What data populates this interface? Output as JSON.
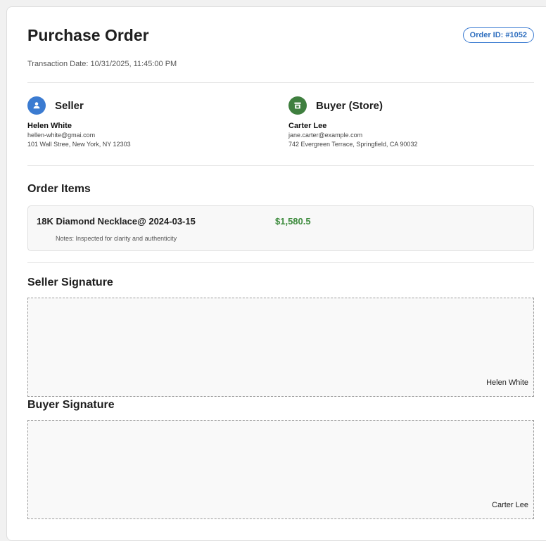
{
  "header": {
    "title": "Purchase Order",
    "order_id": "Order ID: #1052",
    "transaction_date": "Transaction Date: 10/31/2025, 11:45:00 PM"
  },
  "seller": {
    "heading": "Seller",
    "icon": "person-icon",
    "icon_color": "#3b7bd1",
    "name": "Helen White",
    "email": "hellen-white@gmai.com",
    "address": "101 Wall Stree, New York, NY 12303"
  },
  "buyer": {
    "heading": "Buyer (Store)",
    "icon": "store-icon",
    "icon_color": "#3f7f3f",
    "name": "Carter Lee",
    "email": "jane.carter@example.com",
    "address": "742 Evergreen Terrace, Springfield, CA 90032"
  },
  "order_items": {
    "title": "Order Items",
    "items": [
      {
        "name": "18K Diamond Necklace@ 2024-03-15",
        "price": "$1,580.5",
        "notes": "Notes: Inspected for clarity and authenticity"
      }
    ]
  },
  "seller_signature": {
    "title": "Seller Signature",
    "name": "Helen White"
  },
  "buyer_signature": {
    "title": "Buyer Signature",
    "name": "Carter Lee"
  },
  "colors": {
    "accent_blue": "#3b7bd1",
    "price_green": "#3d8b3d"
  }
}
